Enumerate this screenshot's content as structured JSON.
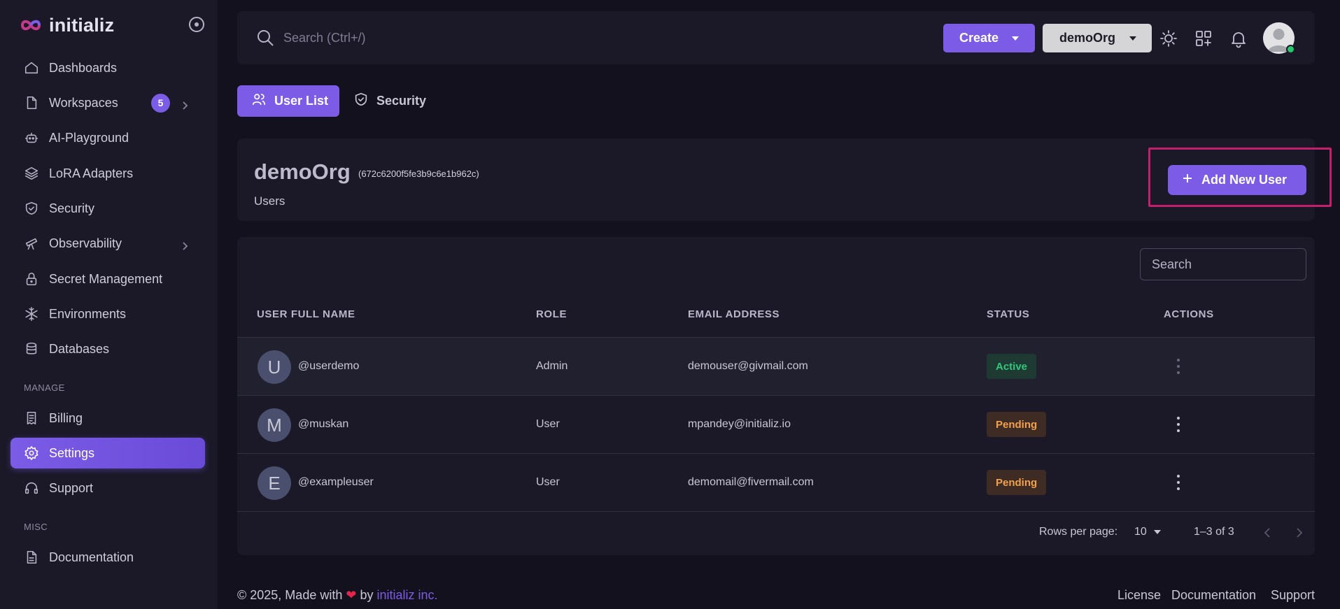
{
  "brand": {
    "name": "initializ"
  },
  "sidebar": {
    "items": [
      {
        "label": "Dashboards"
      },
      {
        "label": "Workspaces",
        "badge": "5"
      },
      {
        "label": "AI-Playground"
      },
      {
        "label": "LoRA Adapters"
      },
      {
        "label": "Security"
      },
      {
        "label": "Observability"
      },
      {
        "label": "Secret Management"
      },
      {
        "label": "Environments"
      },
      {
        "label": "Databases"
      }
    ],
    "manage_label": "MANAGE",
    "manage_items": [
      {
        "label": "Billing"
      },
      {
        "label": "Settings",
        "active": true
      },
      {
        "label": "Support"
      }
    ],
    "misc_label": "MISC",
    "misc_items": [
      {
        "label": "Documentation"
      }
    ]
  },
  "topbar": {
    "search_placeholder": "Search (Ctrl+/)",
    "create_label": "Create",
    "org_label": "demoOrg"
  },
  "tabs": [
    {
      "label": "User List",
      "active": true
    },
    {
      "label": "Security",
      "active": false
    }
  ],
  "header": {
    "org_name": "demoOrg",
    "org_id": "(672c6200f5fe3b9c6e1b962c)",
    "subtitle": "Users",
    "add_user_label": "Add New User"
  },
  "table": {
    "search_placeholder": "Search",
    "columns": [
      "USER FULL NAME",
      "ROLE",
      "EMAIL ADDRESS",
      "STATUS",
      "ACTIONS"
    ],
    "rows": [
      {
        "initial": "U",
        "username": "@userdemo",
        "role": "Admin",
        "email": "demouser@givmail.com",
        "status": "Active"
      },
      {
        "initial": "M",
        "username": "@muskan",
        "role": "User",
        "email": "mpandey@initializ.io",
        "status": "Pending"
      },
      {
        "initial": "E",
        "username": "@exampleuser",
        "role": "User",
        "email": "demomail@fivermail.com",
        "status": "Pending"
      }
    ],
    "rows_per_page_label": "Rows per page:",
    "rows_per_page_value": "10",
    "range_text": "1–3 of 3"
  },
  "footer": {
    "copyright": "© 2025, Made with",
    "heart": "❤",
    "by": "by",
    "company": "initializ inc.",
    "links": [
      "License",
      "Documentation",
      "Support"
    ]
  },
  "colors": {
    "accent": "#7c5ce7",
    "active_status": "#30c87a",
    "pending_status": "#f4a04a",
    "highlight": "#c41e6e"
  }
}
